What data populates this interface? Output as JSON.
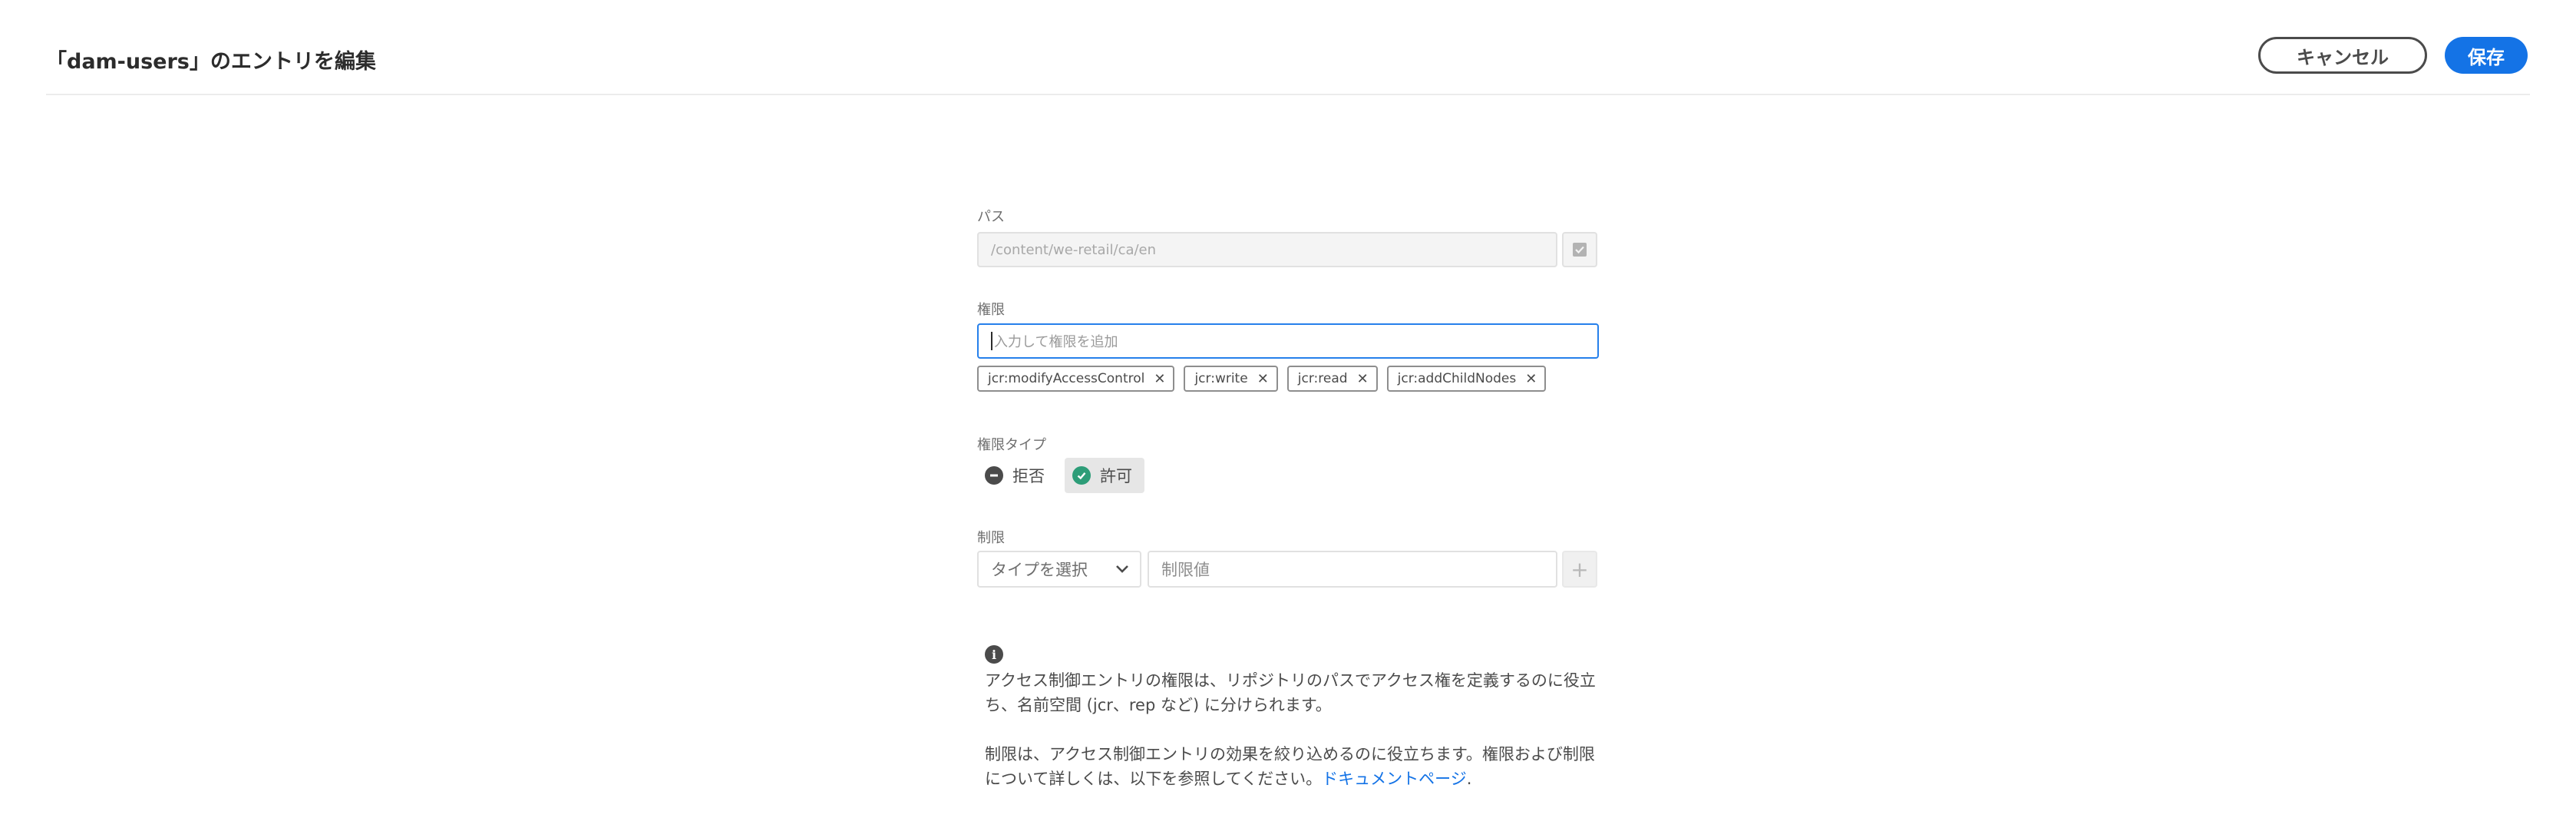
{
  "header": {
    "title": "「dam-users」のエントリを編集",
    "cancel_label": "キャンセル",
    "save_label": "保存"
  },
  "form": {
    "path": {
      "label": "パス",
      "value": "/content/we-retail/ca/en"
    },
    "privileges": {
      "label": "権限",
      "placeholder": "入力して権限を追加",
      "tags": [
        "jcr:modifyAccessControl",
        "jcr:write",
        "jcr:read",
        "jcr:addChildNodes"
      ]
    },
    "permission_type": {
      "label": "権限タイプ",
      "options": [
        {
          "label": "拒否",
          "icon": "minus-circle-icon",
          "selected": false
        },
        {
          "label": "許可",
          "icon": "check-circle-icon",
          "selected": true
        }
      ]
    },
    "restrictions": {
      "label": "制限",
      "type_select": "タイプを選択",
      "value_placeholder": "制限値",
      "add_label": "+"
    }
  },
  "info": {
    "paragraph1": "アクセス制御エントリの権限は、リポジトリのパスでアクセス権を定義するのに役立ち、名前空間 (jcr、rep など) に分けられます。",
    "paragraph2": "制限は、アクセス制御エントリの効果を絞り込めるのに役立ちます。権限および制限について詳しくは、以下を参照してください。",
    "link_label": "ドキュメントページ",
    "link_suffix": "."
  },
  "colors": {
    "accent": "#1473e6",
    "focus_border": "#2680eb",
    "allow_green": "#2d9d78",
    "deny_gray": "#4b4b4b"
  }
}
